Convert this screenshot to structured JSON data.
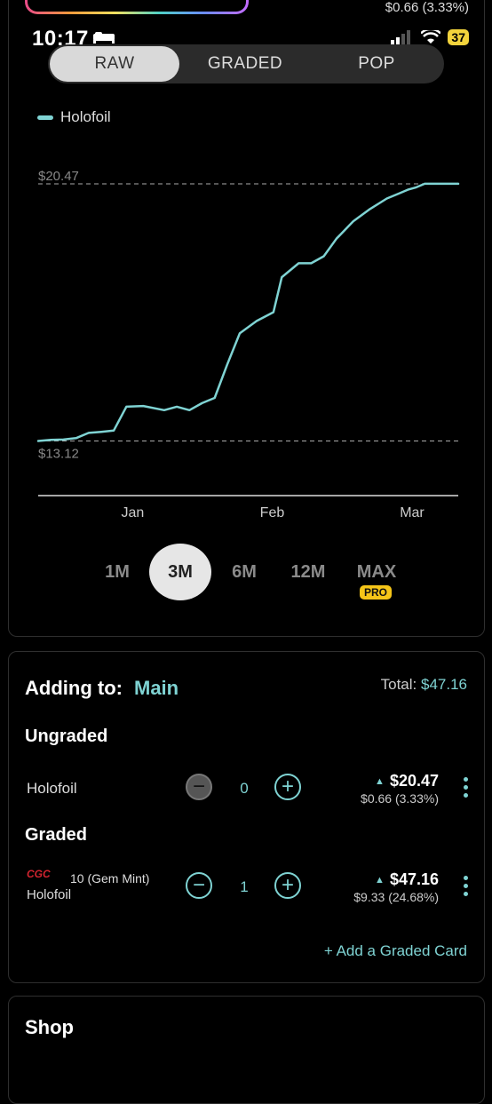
{
  "header": {
    "top_change": "$0.66 (3.33%)"
  },
  "status_bar": {
    "time": "10:17",
    "battery": "37"
  },
  "tabs": {
    "items": [
      "RAW",
      "GRADED",
      "POP"
    ],
    "active": "RAW"
  },
  "chart_data": {
    "type": "line",
    "title": "",
    "xlabel": "",
    "ylabel": "",
    "categories": [
      "Jan",
      "Feb",
      "Mar"
    ],
    "series": [
      {
        "name": "Holofoil",
        "color": "#7fd3d3",
        "x": [
          0,
          3,
          6,
          9,
          12,
          15,
          18,
          21,
          25,
          30,
          33,
          36,
          39,
          42,
          45,
          48,
          52,
          56,
          58,
          62,
          65,
          68,
          71,
          75,
          79,
          83,
          86,
          88,
          90,
          92,
          94,
          96,
          97,
          98,
          99,
          100
        ],
        "values": [
          13.12,
          13.15,
          13.16,
          13.2,
          13.35,
          13.38,
          13.42,
          14.1,
          14.12,
          14.0,
          14.1,
          14.0,
          14.2,
          14.35,
          15.3,
          16.2,
          16.55,
          16.8,
          17.8,
          18.2,
          18.2,
          18.4,
          18.9,
          19.4,
          19.75,
          20.05,
          20.2,
          20.3,
          20.37,
          20.47,
          20.47,
          20.47,
          20.47,
          20.47,
          20.47,
          20.47
        ]
      }
    ],
    "reference_lines": [
      {
        "label": "$20.47",
        "value": 20.47
      },
      {
        "label": "$13.12",
        "value": 13.12
      }
    ],
    "ylim": [
      11.0,
      20.9
    ],
    "grid": false,
    "legend": "top-left"
  },
  "range": {
    "options": [
      "1M",
      "3M",
      "6M",
      "12M",
      "MAX"
    ],
    "active": "3M",
    "pro_badge": "PRO"
  },
  "collection": {
    "adding_label": "Adding to:",
    "target": "Main",
    "total_label": "Total:",
    "total_value": "$47.16",
    "ungraded_title": "Ungraded",
    "graded_title": "Graded",
    "ungraded_row": {
      "label": "Holofoil",
      "minus": "−",
      "qty": "0",
      "plus": "+",
      "price": "$20.47",
      "change": "$0.66 (3.33%)"
    },
    "graded_row": {
      "grader": "CGC",
      "grade": "10 (Gem Mint)",
      "label": "Holofoil",
      "minus": "−",
      "qty": "1",
      "plus": "+",
      "price": "$47.16",
      "change": "$9.33 (24.68%)"
    },
    "add_graded": "+ Add a Graded Card"
  },
  "shop": {
    "title": "Shop"
  }
}
